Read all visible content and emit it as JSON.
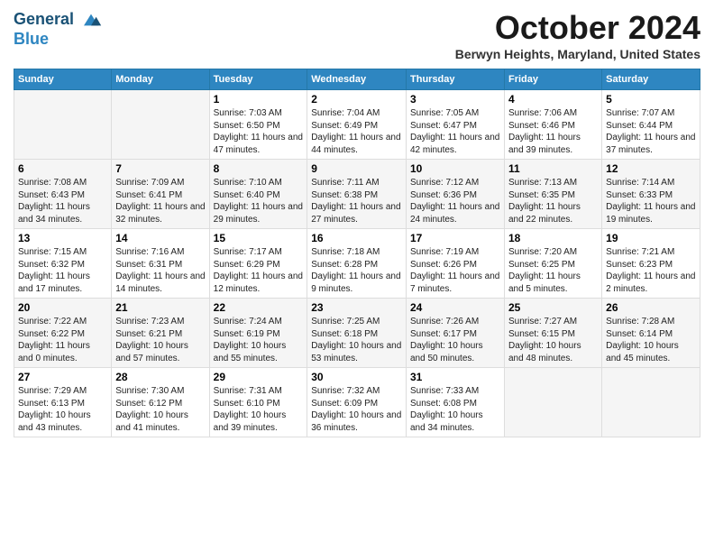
{
  "header": {
    "logo_line1": "General",
    "logo_line2": "Blue",
    "month": "October 2024",
    "location": "Berwyn Heights, Maryland, United States"
  },
  "days_of_week": [
    "Sunday",
    "Monday",
    "Tuesday",
    "Wednesday",
    "Thursday",
    "Friday",
    "Saturday"
  ],
  "weeks": [
    [
      {
        "day": "",
        "info": ""
      },
      {
        "day": "",
        "info": ""
      },
      {
        "day": "1",
        "info": "Sunrise: 7:03 AM\nSunset: 6:50 PM\nDaylight: 11 hours and 47 minutes."
      },
      {
        "day": "2",
        "info": "Sunrise: 7:04 AM\nSunset: 6:49 PM\nDaylight: 11 hours and 44 minutes."
      },
      {
        "day": "3",
        "info": "Sunrise: 7:05 AM\nSunset: 6:47 PM\nDaylight: 11 hours and 42 minutes."
      },
      {
        "day": "4",
        "info": "Sunrise: 7:06 AM\nSunset: 6:46 PM\nDaylight: 11 hours and 39 minutes."
      },
      {
        "day": "5",
        "info": "Sunrise: 7:07 AM\nSunset: 6:44 PM\nDaylight: 11 hours and 37 minutes."
      }
    ],
    [
      {
        "day": "6",
        "info": "Sunrise: 7:08 AM\nSunset: 6:43 PM\nDaylight: 11 hours and 34 minutes."
      },
      {
        "day": "7",
        "info": "Sunrise: 7:09 AM\nSunset: 6:41 PM\nDaylight: 11 hours and 32 minutes."
      },
      {
        "day": "8",
        "info": "Sunrise: 7:10 AM\nSunset: 6:40 PM\nDaylight: 11 hours and 29 minutes."
      },
      {
        "day": "9",
        "info": "Sunrise: 7:11 AM\nSunset: 6:38 PM\nDaylight: 11 hours and 27 minutes."
      },
      {
        "day": "10",
        "info": "Sunrise: 7:12 AM\nSunset: 6:36 PM\nDaylight: 11 hours and 24 minutes."
      },
      {
        "day": "11",
        "info": "Sunrise: 7:13 AM\nSunset: 6:35 PM\nDaylight: 11 hours and 22 minutes."
      },
      {
        "day": "12",
        "info": "Sunrise: 7:14 AM\nSunset: 6:33 PM\nDaylight: 11 hours and 19 minutes."
      }
    ],
    [
      {
        "day": "13",
        "info": "Sunrise: 7:15 AM\nSunset: 6:32 PM\nDaylight: 11 hours and 17 minutes."
      },
      {
        "day": "14",
        "info": "Sunrise: 7:16 AM\nSunset: 6:31 PM\nDaylight: 11 hours and 14 minutes."
      },
      {
        "day": "15",
        "info": "Sunrise: 7:17 AM\nSunset: 6:29 PM\nDaylight: 11 hours and 12 minutes."
      },
      {
        "day": "16",
        "info": "Sunrise: 7:18 AM\nSunset: 6:28 PM\nDaylight: 11 hours and 9 minutes."
      },
      {
        "day": "17",
        "info": "Sunrise: 7:19 AM\nSunset: 6:26 PM\nDaylight: 11 hours and 7 minutes."
      },
      {
        "day": "18",
        "info": "Sunrise: 7:20 AM\nSunset: 6:25 PM\nDaylight: 11 hours and 5 minutes."
      },
      {
        "day": "19",
        "info": "Sunrise: 7:21 AM\nSunset: 6:23 PM\nDaylight: 11 hours and 2 minutes."
      }
    ],
    [
      {
        "day": "20",
        "info": "Sunrise: 7:22 AM\nSunset: 6:22 PM\nDaylight: 11 hours and 0 minutes."
      },
      {
        "day": "21",
        "info": "Sunrise: 7:23 AM\nSunset: 6:21 PM\nDaylight: 10 hours and 57 minutes."
      },
      {
        "day": "22",
        "info": "Sunrise: 7:24 AM\nSunset: 6:19 PM\nDaylight: 10 hours and 55 minutes."
      },
      {
        "day": "23",
        "info": "Sunrise: 7:25 AM\nSunset: 6:18 PM\nDaylight: 10 hours and 53 minutes."
      },
      {
        "day": "24",
        "info": "Sunrise: 7:26 AM\nSunset: 6:17 PM\nDaylight: 10 hours and 50 minutes."
      },
      {
        "day": "25",
        "info": "Sunrise: 7:27 AM\nSunset: 6:15 PM\nDaylight: 10 hours and 48 minutes."
      },
      {
        "day": "26",
        "info": "Sunrise: 7:28 AM\nSunset: 6:14 PM\nDaylight: 10 hours and 45 minutes."
      }
    ],
    [
      {
        "day": "27",
        "info": "Sunrise: 7:29 AM\nSunset: 6:13 PM\nDaylight: 10 hours and 43 minutes."
      },
      {
        "day": "28",
        "info": "Sunrise: 7:30 AM\nSunset: 6:12 PM\nDaylight: 10 hours and 41 minutes."
      },
      {
        "day": "29",
        "info": "Sunrise: 7:31 AM\nSunset: 6:10 PM\nDaylight: 10 hours and 39 minutes."
      },
      {
        "day": "30",
        "info": "Sunrise: 7:32 AM\nSunset: 6:09 PM\nDaylight: 10 hours and 36 minutes."
      },
      {
        "day": "31",
        "info": "Sunrise: 7:33 AM\nSunset: 6:08 PM\nDaylight: 10 hours and 34 minutes."
      },
      {
        "day": "",
        "info": ""
      },
      {
        "day": "",
        "info": ""
      }
    ]
  ]
}
